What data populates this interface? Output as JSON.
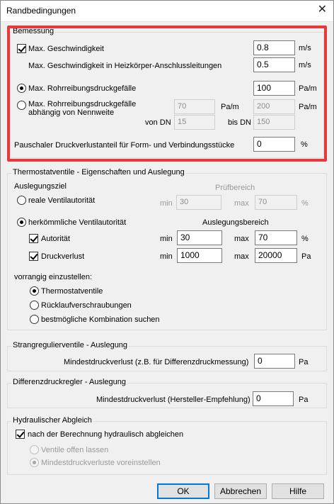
{
  "window": {
    "title": "Randbedingungen",
    "close_glyph": "✕"
  },
  "bemessung": {
    "title": "Bemessung",
    "max_geschw": {
      "label": "Max. Geschwindigkeit",
      "checked": true,
      "value": "0.8",
      "unit": "m/s"
    },
    "max_geschw_heiz": {
      "label": "Max. Geschwindigkeit in Heizkörper-Anschlussleitungen",
      "value": "0.5",
      "unit": "m/s"
    },
    "max_rohr": {
      "label": "Max. Rohrreibungsdruckgefälle",
      "selected": true,
      "value": "100",
      "unit": "Pa/m"
    },
    "max_rohr_nw": {
      "label_line1": "Max. Rohrreibungsdruckgefälle",
      "label_line2": "abhängig von Nennweite",
      "selected": false,
      "value1": "70",
      "unit1": "Pa/m",
      "value2": "200",
      "unit2": "Pa/m",
      "von_dn_label": "von DN",
      "von_dn": "15",
      "bis_dn_label": "bis DN",
      "bis_dn": "150"
    },
    "pauschal": {
      "label": "Pauschaler Druckverlustanteil für Form- und Verbindungsstücke",
      "value": "0",
      "unit": "%"
    }
  },
  "thermo": {
    "title": "Thermostatventile - Eigenschaften und Auslegung",
    "auslegungsziel": "Auslegungsziel",
    "pruefbereich": "Prüfbereich",
    "reale": {
      "label": "reale Ventilautorität",
      "selected": false,
      "min_label": "min",
      "min": "30",
      "max_label": "max",
      "max": "70",
      "unit": "%"
    },
    "herkoemmliche": {
      "label": "herkömmliche Ventilautorität",
      "selected": true
    },
    "auslegungsbereich": "Auslegungsbereich",
    "autoritaet": {
      "label": "Autorität",
      "checked": true,
      "min_label": "min",
      "min": "30",
      "max_label": "max",
      "max": "70",
      "unit": "%"
    },
    "druckverlust": {
      "label": "Druckverlust",
      "checked": true,
      "min_label": "min",
      "min": "1000",
      "max_label": "max",
      "max": "20000",
      "unit": "Pa"
    },
    "vorrangig": "vorrangig einzustellen:",
    "opt_thermo": {
      "label": "Thermostatventile",
      "selected": true
    },
    "opt_ruecklauf": {
      "label": "Rücklaufverschraubungen",
      "selected": false
    },
    "opt_best": {
      "label": "bestmögliche Kombination suchen",
      "selected": false
    }
  },
  "strang": {
    "title": "Strangregulierventile - Auslegung",
    "label": "Mindestdruckverlust (z.B. für Differenzdruckmessung)",
    "value": "0",
    "unit": "Pa"
  },
  "diff": {
    "title": "Differenzdruckregler - Auslegung",
    "label": "Mindestdruckverlust (Hersteller-Empfehlung)",
    "value": "0",
    "unit": "Pa"
  },
  "hydro": {
    "title": "Hydraulischer Abgleich",
    "nach": {
      "label": "nach der Berechnung hydraulisch abgleichen",
      "checked": true
    },
    "offen": {
      "label": "Ventile offen lassen",
      "selected": false
    },
    "mindest": {
      "label": "Mindestdruckverluste voreinstellen",
      "selected": true
    }
  },
  "buttons": {
    "ok": "OK",
    "abbrechen": "Abbrechen",
    "hilfe": "Hilfe"
  }
}
